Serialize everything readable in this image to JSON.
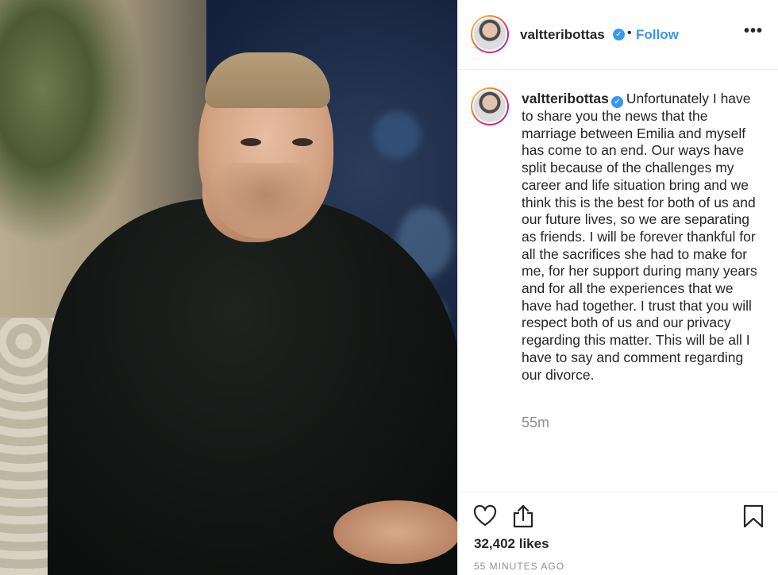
{
  "post": {
    "username": "valtteribottas",
    "follow_label": "Follow",
    "separator": "•",
    "more_label": "•••",
    "verified_mark": "✓",
    "caption": "Unfortunately I have to share you the news that the marriage between Emilia and myself has come to an end. Our ways have split because of the challenges my career and life situation bring and we think this is the best for both of us and our future lives, so we are separating as friends. I will be forever thankful for all the sacrifices she had to make for me, for her support during many years and for all the experiences that we have had together. I trust that you will respect both of us and our privacy regarding this matter. This will be all I have to say and comment regarding our divorce.",
    "caption_time": "55m",
    "likes": "32,402 likes",
    "posted_ago": "55 MINUTES AGO"
  },
  "icons": {
    "like": "heart-icon",
    "share": "share-icon",
    "save": "bookmark-icon",
    "verified": "verified-badge-icon",
    "more": "more-options-icon"
  },
  "colors": {
    "accent": "#3897f0",
    "text": "#262626",
    "muted": "#8e8e8e",
    "border": "#efefef"
  }
}
